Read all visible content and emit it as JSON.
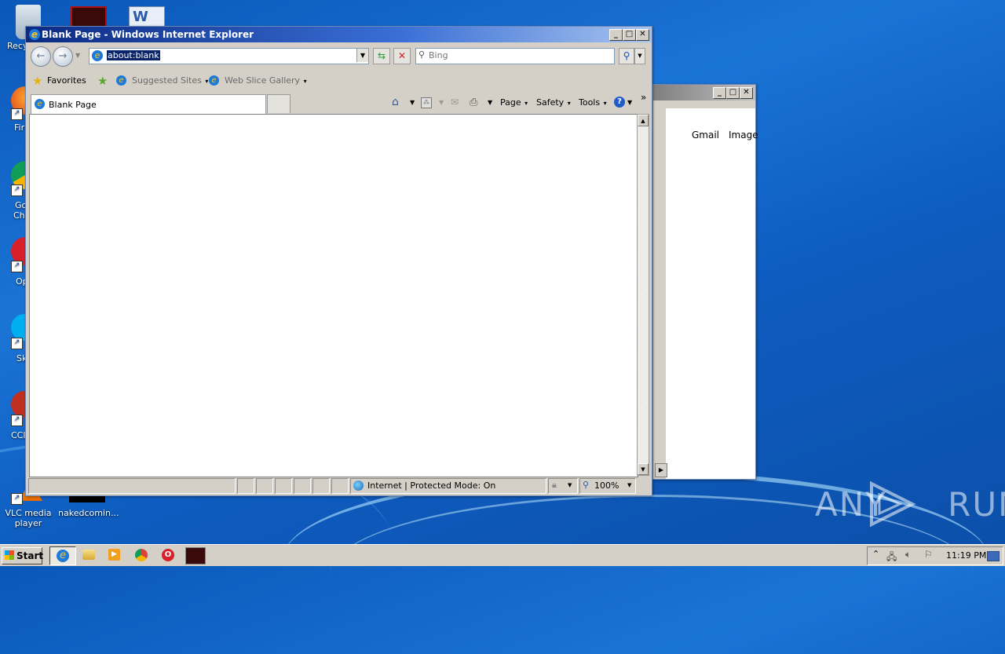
{
  "window": {
    "title": "Blank Page - Windows Internet Explorer"
  },
  "address": {
    "value": "about:blank"
  },
  "search": {
    "placeholder": "Bing"
  },
  "favorites_bar": {
    "favorites_label": "Favorites",
    "suggested_sites": "Suggested Sites",
    "web_slice_gallery": "Web Slice Gallery"
  },
  "tab": {
    "label": "Blank Page"
  },
  "command_bar": {
    "page": "Page",
    "safety": "Safety",
    "tools": "Tools"
  },
  "statusbar": {
    "zone": "Internet | Protected Mode: On",
    "zoom": "100%"
  },
  "background_window": {
    "links": [
      "Gmail",
      "Image"
    ]
  },
  "desktop_icons": {
    "recycle": "Recy",
    "firefox": "Fir",
    "chrome_line1": "Go",
    "chrome_line2": "Chr",
    "opera": "Op",
    "skype": "Sk",
    "ccleaner": "CCl",
    "vlc_line1": "VLC media",
    "vlc_line2": "player",
    "file": "nakedcomin..."
  },
  "taskbar": {
    "start_label": "Start",
    "clock": "11:19 PM"
  },
  "watermark": {
    "text": "ANY RUN"
  },
  "colors": {
    "title_active": "#0b2a82",
    "selection": "#0a246a",
    "taskbar": "#d4d0c8"
  }
}
